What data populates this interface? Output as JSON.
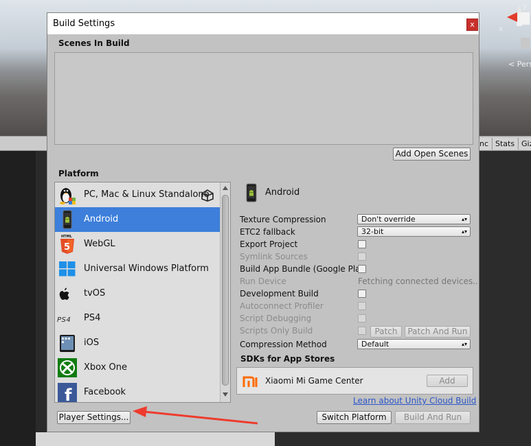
{
  "dialog": {
    "title": "Build Settings",
    "close_glyph": "x",
    "scenes_label": "Scenes In Build",
    "add_open_scenes": "Add Open Scenes",
    "platform_label": "Platform",
    "platforms": [
      {
        "label": "PC, Mac & Linux Standalone",
        "icon": "linux-tux-icon"
      },
      {
        "label": "Android",
        "icon": "android-phone-icon",
        "selected": true
      },
      {
        "label": "WebGL",
        "icon": "html5-icon"
      },
      {
        "label": "Universal Windows Platform",
        "icon": "windows-icon"
      },
      {
        "label": "tvOS",
        "icon": "apple-tv-icon"
      },
      {
        "label": "PS4",
        "icon": "ps4-logo-icon"
      },
      {
        "label": "iOS",
        "icon": "ipad-icon"
      },
      {
        "label": "Xbox One",
        "icon": "xbox-icon"
      },
      {
        "label": "Facebook",
        "icon": "facebook-icon"
      }
    ],
    "selected_platform": "Android",
    "settings": {
      "texture_compression": {
        "label": "Texture Compression",
        "value": "Don't override"
      },
      "etc2_fallback": {
        "label": "ETC2 fallback",
        "value": "32-bit"
      },
      "export_project": {
        "label": "Export Project"
      },
      "symlink_sources": {
        "label": "Symlink Sources"
      },
      "build_app_bundle": {
        "label": "Build App Bundle (Google Play)"
      },
      "run_device": {
        "label": "Run Device",
        "value": "Fetching connected devices.."
      },
      "development_build": {
        "label": "Development Build"
      },
      "autoconnect_profiler": {
        "label": "Autoconnect Profiler"
      },
      "script_debugging": {
        "label": "Script Debugging"
      },
      "scripts_only_build": {
        "label": "Scripts Only Build"
      },
      "patch": "Patch",
      "patch_and_run": "Patch And Run",
      "compression_method": {
        "label": "Compression Method",
        "value": "Default"
      }
    },
    "sdks_label": "SDKs for App Stores",
    "sdk_name": "Xiaomi Mi Game Center",
    "sdk_add": "Add",
    "cloud_link": "Learn about Unity Cloud Build",
    "player_settings": "Player Settings...",
    "switch_platform": "Switch Platform",
    "build_and_run": "Build And Run"
  },
  "background": {
    "persp_label": "< Pers",
    "tab_sync": "nc",
    "tab_stats": "Stats",
    "tab_gizmos": "Giz",
    "gizmo_y": "y",
    "gizmo_x": "x"
  },
  "colors": {
    "selected_row": "#3d7fdb",
    "close_button": "#c8302c",
    "annotation_arrow": "#ee3b2e",
    "link": "#2b56c8"
  }
}
